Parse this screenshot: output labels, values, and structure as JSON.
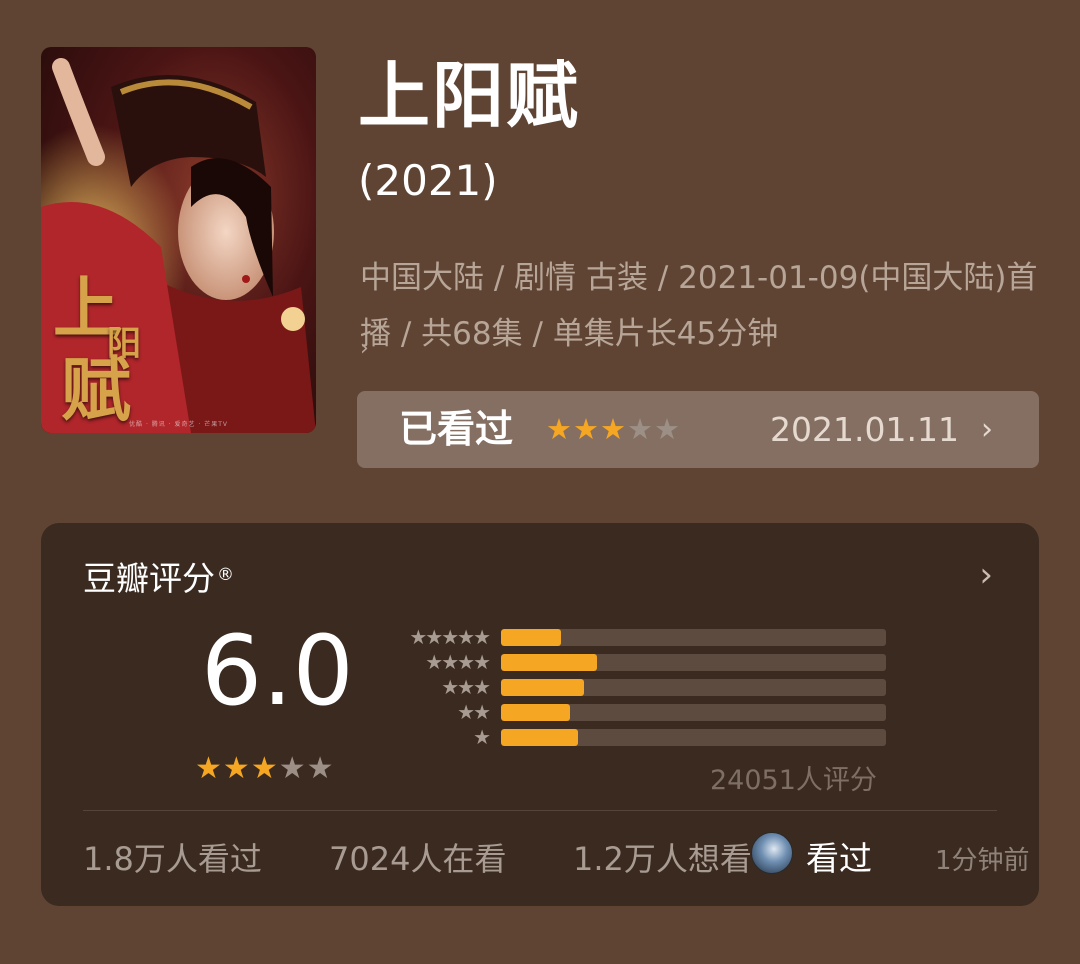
{
  "poster": {
    "title_calligraphy": [
      "上",
      "阳",
      "赋"
    ],
    "credits": "优酷 · 腾讯 · 爱奇艺 · 芒果TV"
  },
  "movie": {
    "title": "上阳赋",
    "year": "(2021)",
    "meta": "中国大陆 / 剧情 古装 / 2021-01-09(中国大陆)首播 / 共68集 / 单集片长45分钟",
    "meta_more_icon": "chevron-right-icon"
  },
  "user_status": {
    "label": "已看过",
    "stars": [
      "★",
      "★",
      "★",
      "★",
      "★"
    ],
    "rating": 3,
    "date": "2021.01.11",
    "chevron": "›"
  },
  "rating": {
    "title": "豆瓣评分",
    "registered_mark": "®",
    "chevron": "›",
    "score": "6.0",
    "score_stars": [
      "★",
      "★",
      "★",
      "★",
      "★"
    ],
    "score_star_count": 3,
    "distribution": [
      {
        "stars": "★★★★★",
        "fraction": 0.155
      },
      {
        "stars": "★★★★",
        "fraction": 0.25
      },
      {
        "stars": "★★★",
        "fraction": 0.215
      },
      {
        "stars": "★★",
        "fraction": 0.18
      },
      {
        "stars": "★",
        "fraction": 0.2
      }
    ],
    "count": "24051人评分"
  },
  "stats": {
    "watched": "1.8万人看过",
    "watching": "7024人在看",
    "want": "1.2万人想看"
  },
  "activity": {
    "label": "看过",
    "time": "1分钟前"
  },
  "colors": {
    "background": "#5f4433",
    "card": "#3a2a20",
    "star_active": "#f5a623",
    "star_inactive": "#9c8f86"
  }
}
